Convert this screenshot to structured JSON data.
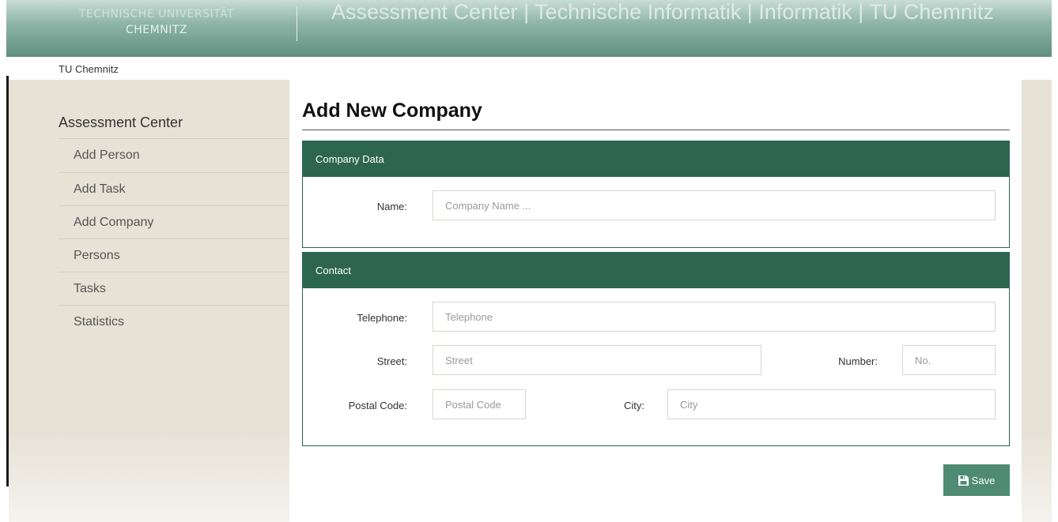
{
  "header": {
    "logo_line1": "TECHNISCHE UNIVERSITÄT",
    "logo_line2": "CHEMNITZ",
    "title": "Assessment Center | Technische Informatik | Informatik | TU Chemnitz"
  },
  "breadcrumb": "TU Chemnitz",
  "sidebar": {
    "heading": "Assessment Center",
    "items": [
      {
        "label": "Add Person"
      },
      {
        "label": "Add Task"
      },
      {
        "label": "Add Company"
      },
      {
        "label": "Persons"
      },
      {
        "label": "Tasks"
      },
      {
        "label": "Statistics"
      }
    ]
  },
  "page_title": "Add New Company",
  "company_panel": {
    "title": "Company Data",
    "name_label": "Name:",
    "name_placeholder": "Company Name ...",
    "name_value": ""
  },
  "contact_panel": {
    "title": "Contact",
    "telephone_label": "Telephone:",
    "telephone_placeholder": "Telephone",
    "street_label": "Street:",
    "street_placeholder": "Street",
    "number_label": "Number:",
    "number_placeholder": "No.",
    "postal_label": "Postal Code:",
    "postal_placeholder": "Postal Code",
    "city_label": "City:",
    "city_placeholder": "City"
  },
  "save_button": {
    "label": "Save",
    "icon": "floppy-disk-icon"
  },
  "colors": {
    "accent": "#2d6650",
    "button": "#4f8a75",
    "sidebar": "#e6e2d6"
  }
}
